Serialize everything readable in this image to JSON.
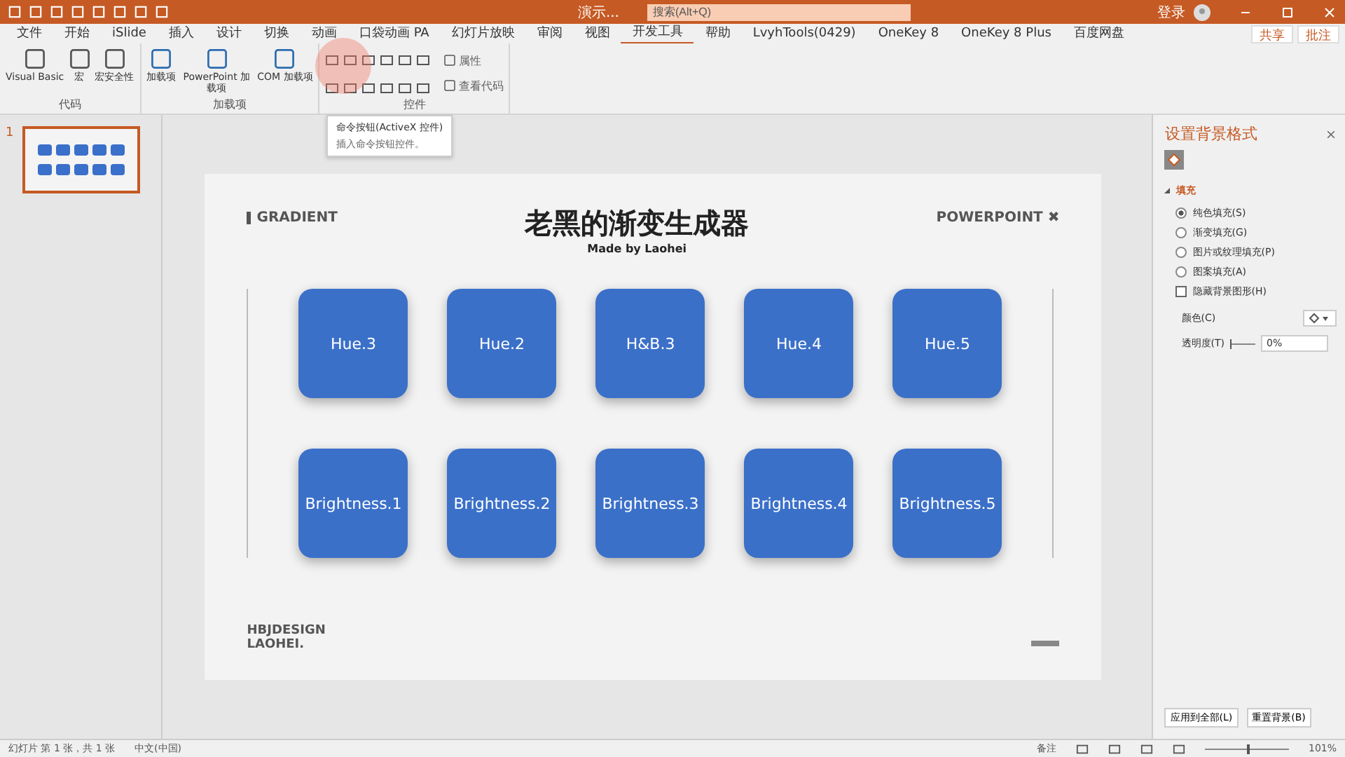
{
  "window": {
    "title": "演示...",
    "search": {
      "placeholder": "搜索(Alt+Q)"
    },
    "account": "登录"
  },
  "tabs": [
    {
      "label": "文件",
      "selected": false
    },
    {
      "label": "开始",
      "selected": false
    },
    {
      "label": "iSlide",
      "selected": false
    },
    {
      "label": "插入",
      "selected": false
    },
    {
      "label": "设计",
      "selected": false
    },
    {
      "label": "切换",
      "selected": false
    },
    {
      "label": "动画",
      "selected": false
    },
    {
      "label": "口袋动画 PA",
      "selected": false
    },
    {
      "label": "幻灯片放映",
      "selected": false
    },
    {
      "label": "审阅",
      "selected": false
    },
    {
      "label": "视图",
      "selected": false
    },
    {
      "label": "开发工具",
      "selected": true
    },
    {
      "label": "帮助",
      "selected": false
    },
    {
      "label": "LvyhTools(0429)",
      "selected": false
    },
    {
      "label": "OneKey 8",
      "selected": false
    },
    {
      "label": "OneKey 8 Plus",
      "selected": false
    },
    {
      "label": "百度网盘",
      "selected": false
    }
  ],
  "share_buttons": [
    "共享",
    "批注"
  ],
  "ribbon_groups": [
    {
      "name": "代码",
      "buttons": [
        "Visual Basic",
        "宏",
        "宏安全性"
      ]
    },
    {
      "name": "加载项",
      "buttons": [
        "加载项",
        "PowerPoint 加载项",
        "COM 加载项"
      ]
    },
    {
      "name": "控件",
      "buttons": [
        "属性",
        "查看代码"
      ]
    }
  ],
  "tooltip": {
    "title": "命令按钮(ActiveX 控件)",
    "text": "插入命令按钮控件。"
  },
  "thumbnail": {
    "number": "1",
    "selected": true
  },
  "slide": {
    "left_tag": "GRADIENT",
    "title": "老黑的渐变生成器",
    "subtitle": "Made by Laohei",
    "right_tag": "POWERPOINT ✖",
    "rows": [
      [
        "Hue.3",
        "Hue.2",
        "H&B.3",
        "Hue.4",
        "Hue.5"
      ],
      [
        "Brightness.1",
        "Brightness.2",
        "Brightness.3",
        "Brightness.4",
        "Brightness.5"
      ]
    ],
    "footer": [
      "HBJDESIGN",
      "LAOHEI."
    ]
  },
  "pane": {
    "title": "设置背景格式",
    "section": "填充",
    "options": [
      {
        "label": "纯色填充(S)",
        "kind": "radio",
        "selected": true
      },
      {
        "label": "渐变填充(G)",
        "kind": "radio",
        "selected": false
      },
      {
        "label": "图片或纹理填充(P)",
        "kind": "radio",
        "selected": false
      },
      {
        "label": "图案填充(A)",
        "kind": "radio",
        "selected": false
      },
      {
        "label": "隐藏背景图形(H)",
        "kind": "checkbox",
        "checked": false
      }
    ],
    "color_label": "颜色(C)",
    "transparency_label": "透明度(T)",
    "transparency": {
      "level": 0,
      "reading": "0%"
    },
    "buttons": [
      "应用到全部(L)",
      "重置背景(B)"
    ]
  },
  "status_bar": {
    "slide_info": "幻灯片 第 1 张，共 1 张",
    "language": "中文(中国)",
    "notes": "备注",
    "zoom": "101%",
    "zoom_slider": {
      "level": 0.5
    }
  }
}
